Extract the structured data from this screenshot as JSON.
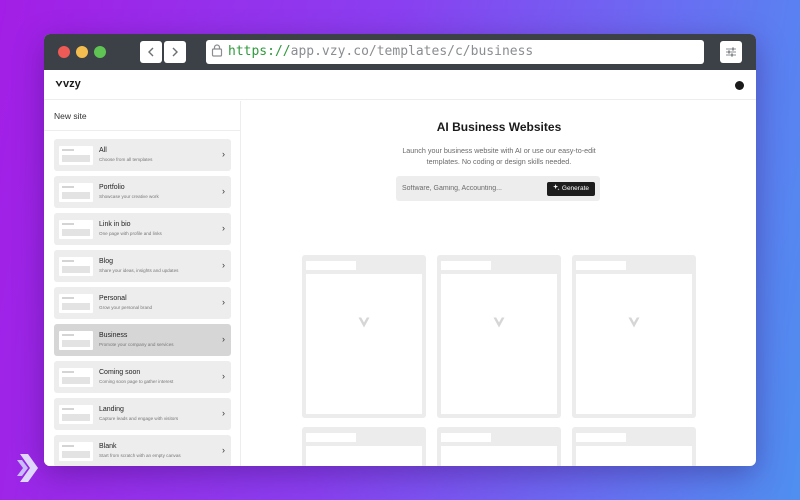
{
  "browser": {
    "url_scheme": "https://",
    "url_rest": "app.vzy.co/templates/c/business",
    "back_icon": "chevron-left-icon",
    "forward_icon": "chevron-right-icon",
    "settings_icon": "sliders-icon"
  },
  "app": {
    "logo": "vzy",
    "theme_icon": "moon-icon"
  },
  "sidebar": {
    "title": "New site",
    "items": [
      {
        "name": "All",
        "desc": "Choose from all templates",
        "active": false
      },
      {
        "name": "Portfolio",
        "desc": "Showcase your creative work",
        "active": false
      },
      {
        "name": "Link in bio",
        "desc": "One page with profile and links",
        "active": false
      },
      {
        "name": "Blog",
        "desc": "Share your ideas, insights and updates",
        "active": false
      },
      {
        "name": "Personal",
        "desc": "Grow your personal brand",
        "active": false
      },
      {
        "name": "Business",
        "desc": "Promote your company and services",
        "active": true
      },
      {
        "name": "Coming soon",
        "desc": "Coming soon page to gather interest",
        "active": false
      },
      {
        "name": "Landing",
        "desc": "Capture leads and engage with visitors",
        "active": false
      },
      {
        "name": "Blank",
        "desc": "Start from scratch with an empty canvas",
        "active": false
      }
    ]
  },
  "main": {
    "title": "AI Business Websites",
    "subtitle": "Launch your business website with AI or use our easy-to-edit templates. No coding or design skills needed.",
    "prompt_placeholder": "Software, Gaming, Accounting...",
    "generate_label": "Generate"
  },
  "colors": {
    "active_item": "#d6d6d6",
    "generate_button": "#1d1d1d",
    "url_scheme": "#2f9a3c"
  }
}
